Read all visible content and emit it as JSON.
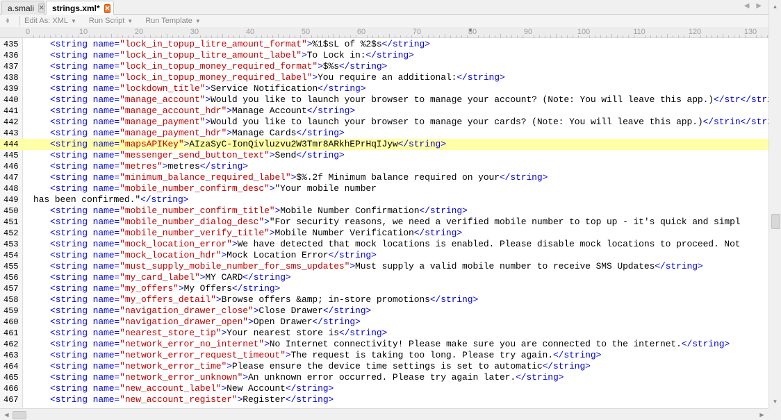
{
  "tabs": [
    {
      "label": "a.smali",
      "active": false,
      "close_icon": "close-icon"
    },
    {
      "label": "strings.xml*",
      "active": true,
      "close_icon": "close-icon"
    }
  ],
  "toolbar": {
    "edit_as": "Edit As: XML",
    "run_script": "Run Script",
    "run_template": "Run Template"
  },
  "ruler": {
    "labels": [
      "0",
      "10",
      "20",
      "30",
      "40",
      "50",
      "60",
      "70",
      "80",
      "90",
      "100",
      "110",
      "120",
      "130"
    ]
  },
  "editor": {
    "highlighted_line": "444",
    "lines": [
      {
        "num": "435",
        "name": "lock_in_topup_litre_amount_format",
        "value": "%1$sL of %2$s"
      },
      {
        "num": "436",
        "name": "lock_in_topup_litre_amount_label",
        "value": "To Lock in:"
      },
      {
        "num": "437",
        "name": "lock_in_topup_money_required_format",
        "value": "$%s"
      },
      {
        "num": "438",
        "name": "lock_in_topup_money_required_label",
        "value": "You require an additional:"
      },
      {
        "num": "439",
        "name": "lockdown_title",
        "value": "Service Notification"
      },
      {
        "num": "440",
        "name": "manage_account",
        "value": "Would you like to launch your browser to manage your account? (Note: You will leave this app.)</str"
      },
      {
        "num": "441",
        "name": "manage_account_hdr",
        "value": "Manage Account"
      },
      {
        "num": "442",
        "name": "manage_payment",
        "value": "Would you like to launch your browser to manage your cards? (Note: You will leave this app.)</strin"
      },
      {
        "num": "443",
        "name": "manage_payment_hdr",
        "value": "Manage Cards"
      },
      {
        "num": "444",
        "name": "mapsAPIKey",
        "value": "AIzaSyC-IonQivluzvu2W3Tmr8ARkhEPrHqIJyw"
      },
      {
        "num": "445",
        "name": "messenger_send_button_text",
        "value": "Send"
      },
      {
        "num": "446",
        "name": "metres",
        "value": "metres"
      },
      {
        "num": "447",
        "name": "minimum_balance_required_label",
        "value": "$%.2f Minimum balance required on your"
      },
      {
        "num": "448",
        "name": "mobile_number_confirm_desc",
        "value": "\"Your mobile number",
        "open_only": true
      },
      {
        "num": "449",
        "continuation": "has been confirmed.\""
      },
      {
        "num": "450",
        "name": "mobile_number_confirm_title",
        "value": "Mobile Number Confirmation"
      },
      {
        "num": "451",
        "name": "mobile_number_dialog_desc",
        "value": "\"For security reasons, we need a verified mobile number to top up - it's quick and simpl",
        "open_only": true
      },
      {
        "num": "452",
        "name": "mobile_number_verify_title",
        "value": "Mobile Number Verification"
      },
      {
        "num": "453",
        "name": "mock_location_error",
        "value": "We have detected that mock locations is enabled. Please disable mock locations to proceed. Not",
        "open_only": true
      },
      {
        "num": "454",
        "name": "mock_location_hdr",
        "value": "Mock Location Error"
      },
      {
        "num": "455",
        "name": "must_supply_mobile_number_for_sms_updates",
        "value": "Must supply a valid mobile number to receive SMS Updates"
      },
      {
        "num": "456",
        "name": "my_card_label",
        "value": "MY CARD"
      },
      {
        "num": "457",
        "name": "my_offers",
        "value": "My Offers"
      },
      {
        "num": "458",
        "name": "my_offers_detail",
        "value": "Browse offers &amp; in-store promotions"
      },
      {
        "num": "459",
        "name": "navigation_drawer_close",
        "value": "Close Drawer"
      },
      {
        "num": "460",
        "name": "navigation_drawer_open",
        "value": "Open Drawer"
      },
      {
        "num": "461",
        "name": "nearest_store_tip",
        "value": "Your nearest store is"
      },
      {
        "num": "462",
        "name": "network_error_no_internet",
        "value": "No Internet connectivity! Please make sure you are connected to the internet."
      },
      {
        "num": "463",
        "name": "network_error_request_timeout",
        "value": "The request is taking too long. Please try again."
      },
      {
        "num": "464",
        "name": "network_error_time",
        "value": "Please ensure the device time settings is set to automatic"
      },
      {
        "num": "465",
        "name": "network_error_unknown",
        "value": "An unknown error occurred. Please try again later."
      },
      {
        "num": "466",
        "name": "new_account_label",
        "value": "New Account"
      },
      {
        "num": "467",
        "name": "new_account_register",
        "value": "Register"
      }
    ]
  }
}
